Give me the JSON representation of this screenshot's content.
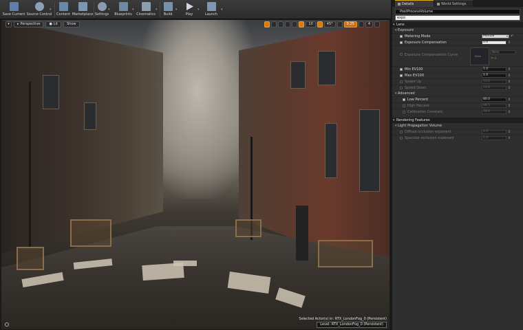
{
  "toolbar": {
    "buttons": [
      {
        "label": "Save Current",
        "icon": "save-icon",
        "color": "#5f7fa6"
      },
      {
        "label": "Source Control",
        "icon": "source-control-icon",
        "color": "#8aa0b4"
      },
      {
        "label": "Content",
        "icon": "content-icon",
        "color": "#6a86a8"
      },
      {
        "label": "Marketplace",
        "icon": "marketplace-icon",
        "color": "#7d96b2"
      },
      {
        "label": "Settings",
        "icon": "gear-icon",
        "color": "#8a9bb0"
      },
      {
        "label": "Blueprints",
        "icon": "blueprint-icon",
        "color": "#6f88a6"
      },
      {
        "label": "Cinematics",
        "icon": "clapper-icon",
        "color": "#8d9db0"
      },
      {
        "label": "Build",
        "icon": "build-icon",
        "color": "#7990ab"
      },
      {
        "label": "Play",
        "icon": "play-icon",
        "color": "#cfd8e2"
      },
      {
        "label": "Launch",
        "icon": "launch-icon",
        "color": "#7f96b2"
      }
    ]
  },
  "viewport": {
    "perspective_label": "Perspective",
    "lit_label": "Lit",
    "show_label": "Show",
    "grid_snap": "10",
    "rotation_snap": "45°",
    "scale_snap": "0.25",
    "camera_speed": "4",
    "selected_text": "Selected Actor(s) in:   RTX_LondonFog_0 (Persistent)",
    "level_text": "Level:  RTX_LondonFog_0 (Persistent)",
    "accent_color": "#d77a12"
  },
  "panel": {
    "tabs": [
      {
        "label": "Details",
        "active": true
      },
      {
        "label": "World Settings",
        "active": false
      }
    ],
    "actor_name": "PostProcessVolume",
    "search_value": "expo",
    "lens_label": "Lens",
    "exposure_label": "Exposure",
    "metering_mode_label": "Metering Mode",
    "metering_mode_value": "Manual",
    "exposure_comp_label": "Exposure Compensation",
    "exposure_comp_value": "0.0",
    "curve_label": "Exposure Compensation Curve",
    "curve_thumb_label": "None",
    "curve_none": "None",
    "min_ev_label": "Min EV100",
    "min_ev_value": "1.0",
    "max_ev_label": "Max EV100",
    "max_ev_value": "1.0",
    "speed_up_label": "Speed Up",
    "speed_up_value": "10.0",
    "speed_down_label": "Speed Down",
    "speed_down_value": "10.0",
    "advanced_label": "Advanced",
    "low_percent_label": "Low Percent",
    "low_percent_value": "80.0",
    "high_percent_label": "High Percent",
    "high_percent_value": "98.5",
    "calib_label": "Calibration Constant",
    "calib_value": "16.0",
    "rendering_label": "Rendering Features",
    "lpv_label": "Light Propagation Volume",
    "diffuse_occ_label": "Diffuse occlusion exponent",
    "diffuse_occ_value": "1.0",
    "specular_occ_label": "Specular occlusion exponent",
    "specular_occ_value": "1.0",
    "tab_accent": "#e4a814"
  }
}
